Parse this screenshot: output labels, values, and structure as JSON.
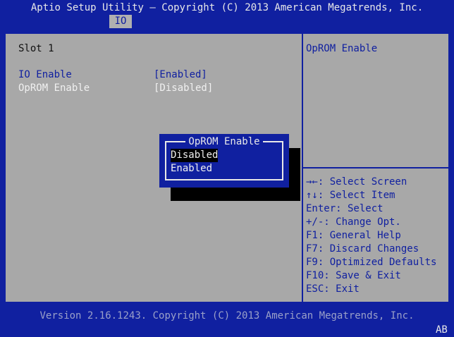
{
  "header": {
    "title": "Aptio Setup Utility – Copyright (C) 2013 American Megatrends, Inc.",
    "tab": "IO"
  },
  "main": {
    "section": "Slot 1",
    "items": [
      {
        "label": "IO Enable",
        "value": "[Enabled]"
      },
      {
        "label": "OpROM Enable",
        "value": "[Disabled]"
      }
    ]
  },
  "help": {
    "description": "OpROM Enable",
    "keys": [
      "→←: Select Screen",
      "↑↓: Select Item",
      "Enter: Select",
      "+/-: Change Opt.",
      "F1: General Help",
      "F7: Discard Changes",
      "F9: Optimized Defaults",
      "F10: Save & Exit",
      "ESC: Exit"
    ]
  },
  "popup": {
    "title": "OpROM Enable",
    "options": [
      "Disabled",
      "Enabled"
    ],
    "selected": "Disabled"
  },
  "footer": {
    "version": "Version 2.16.1243. Copyright (C) 2013 American Megatrends, Inc.",
    "badge": "AB"
  },
  "colors": {
    "background": "#1020a0",
    "panel": "#a8a8a8",
    "highlight": "#1020a0",
    "text": "#101010"
  }
}
